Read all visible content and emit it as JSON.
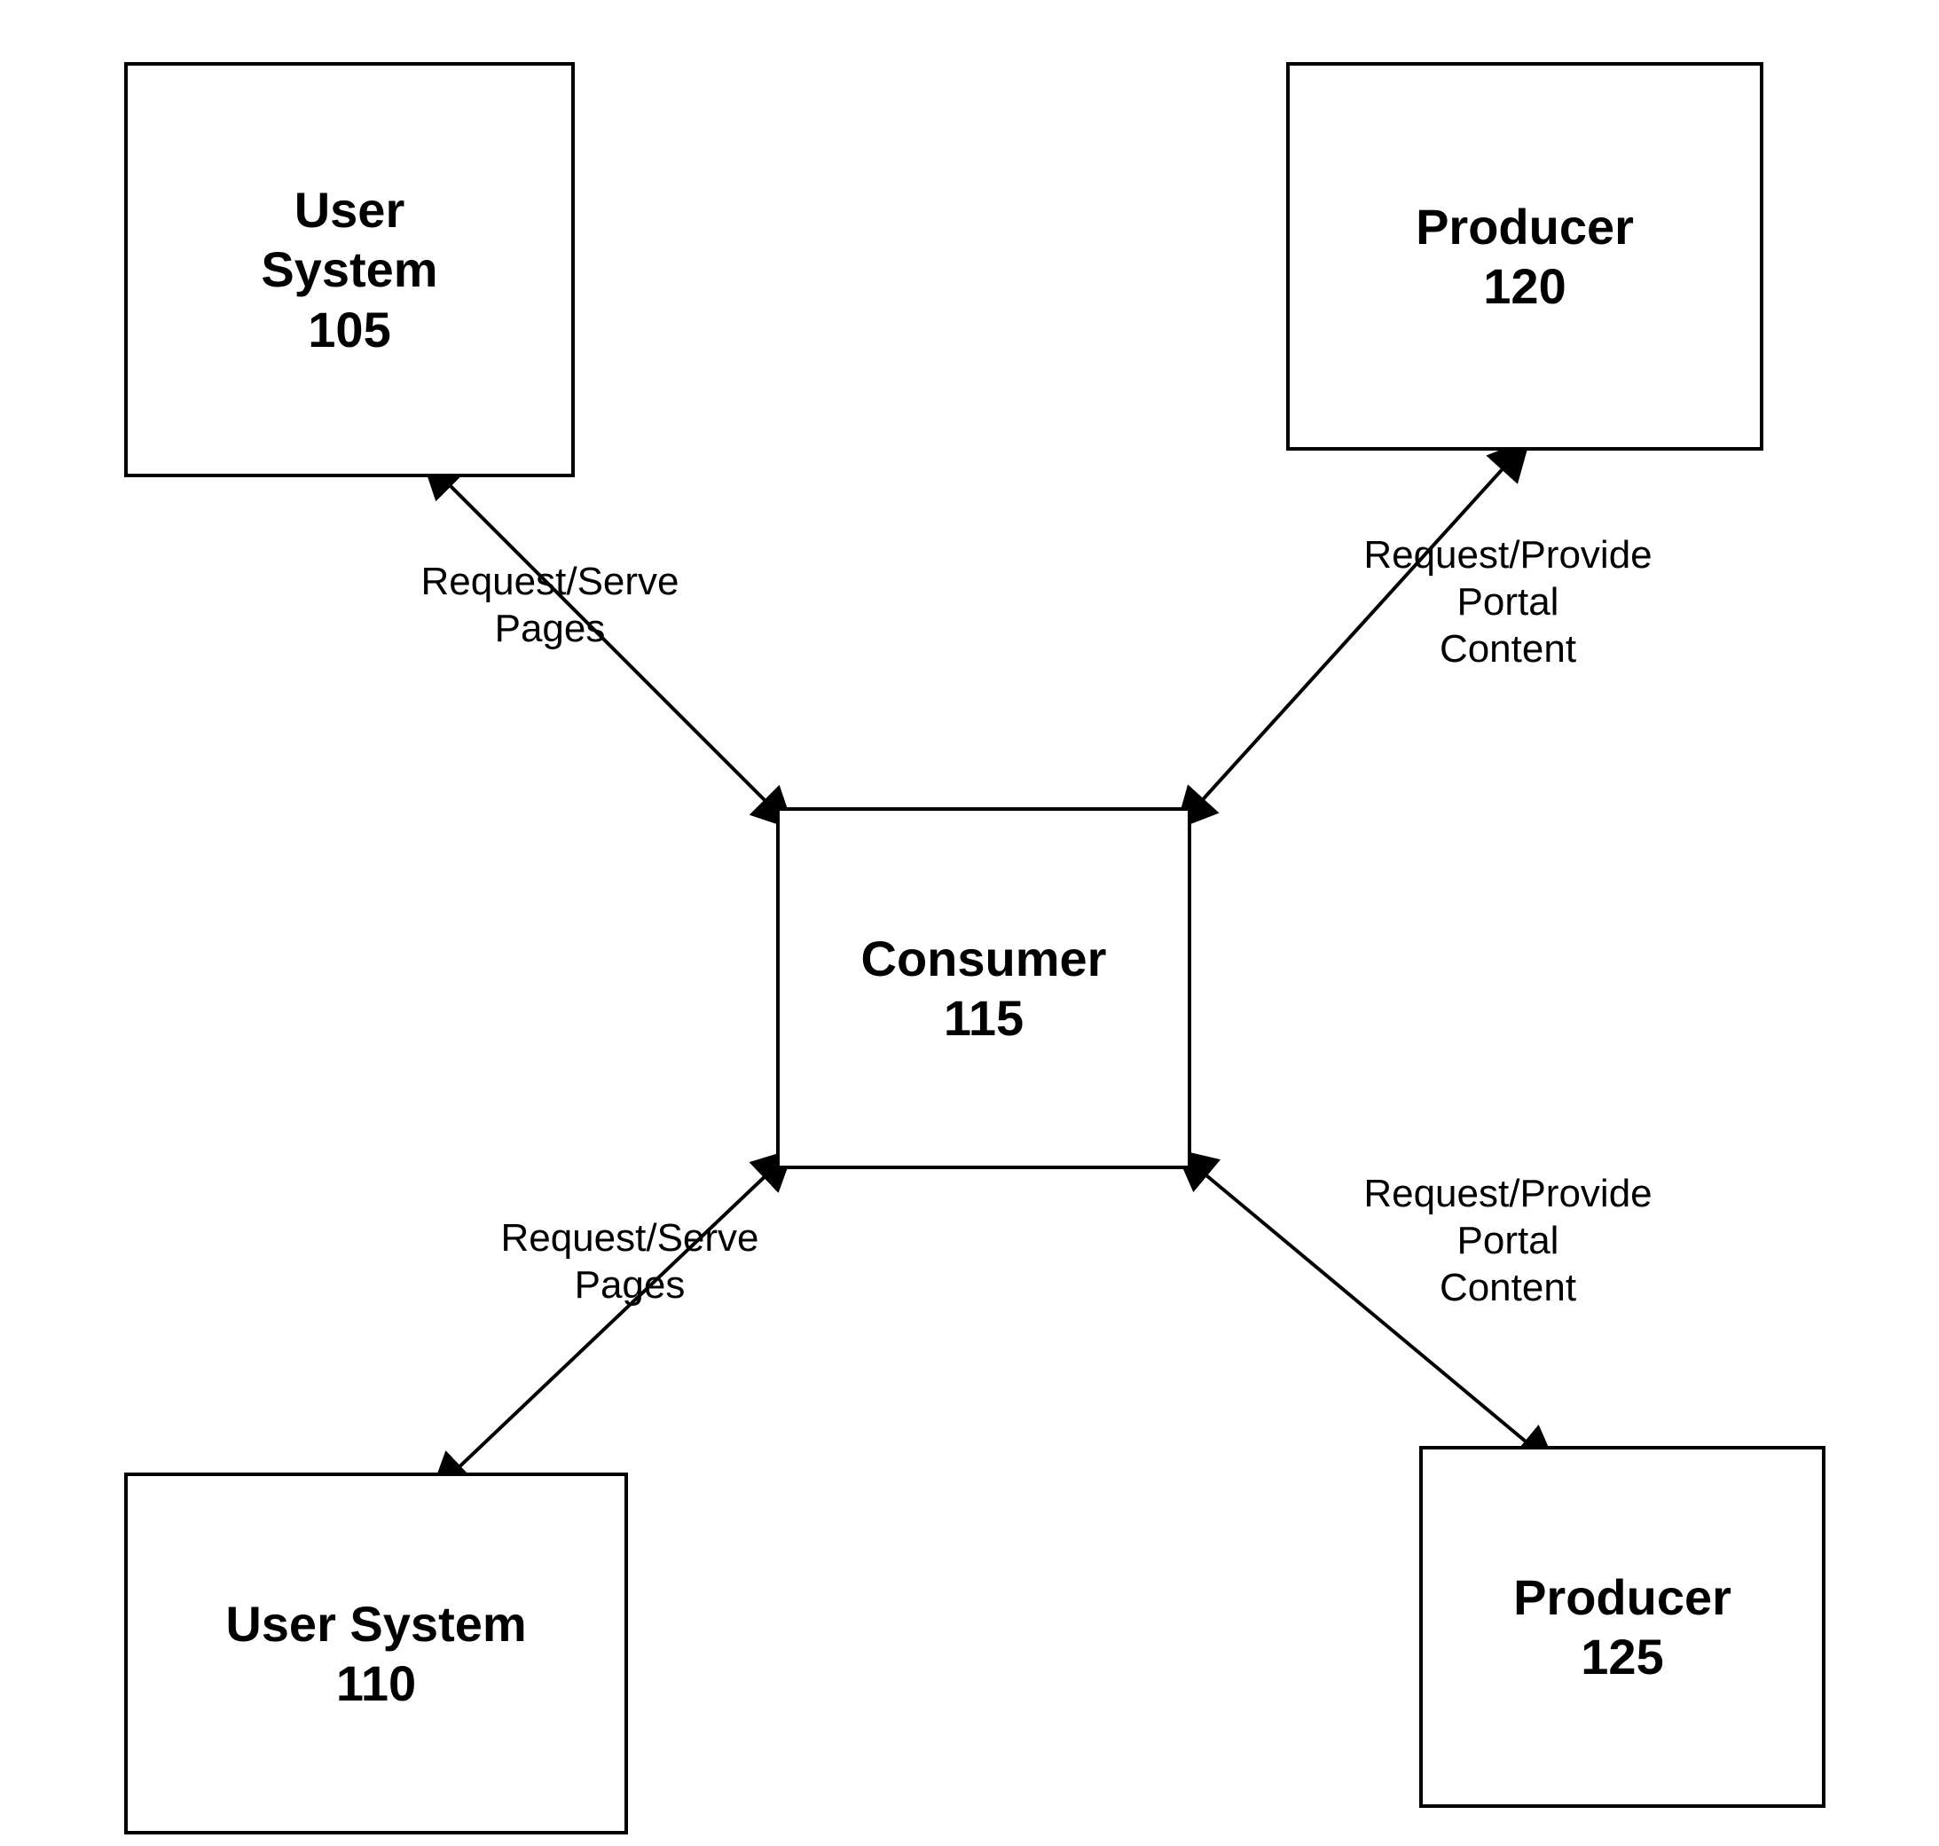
{
  "nodes": {
    "userSystem105": {
      "label": "User\nSystem",
      "number": "105"
    },
    "userSystem110": {
      "label": "User System",
      "number": "110"
    },
    "consumer115": {
      "label": "Consumer",
      "number": "115"
    },
    "producer120": {
      "label": "Producer",
      "number": "120"
    },
    "producer125": {
      "label": "Producer",
      "number": "125"
    }
  },
  "edges": {
    "topLeft": {
      "label": "Request/Serve\nPages"
    },
    "bottomLeft": {
      "label": "Request/Serve\nPages"
    },
    "topRight": {
      "label": "Request/Provide\nPortal\nContent"
    },
    "bottomRight": {
      "label": "Request/Provide\nPortal\nContent"
    }
  }
}
